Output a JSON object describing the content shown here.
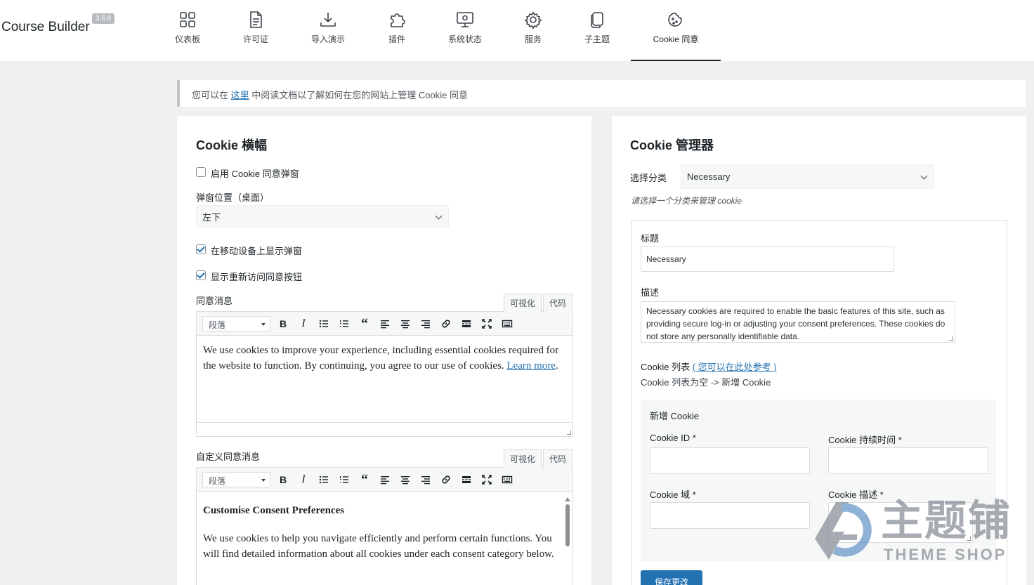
{
  "brand": {
    "name": "Course Builder",
    "version": "3.6.8"
  },
  "nav": [
    {
      "label": "仪表板",
      "icon": "dashboard-icon"
    },
    {
      "label": "许可证",
      "icon": "document-icon"
    },
    {
      "label": "导入演示",
      "icon": "download-icon"
    },
    {
      "label": "插件",
      "icon": "puzzle-icon"
    },
    {
      "label": "系统状态",
      "icon": "monitor-gear-icon"
    },
    {
      "label": "服务",
      "icon": "gear-icon"
    },
    {
      "label": "子主题",
      "icon": "copy-icon"
    },
    {
      "label": "Cookie 同意",
      "icon": "cookie-icon",
      "active": true
    }
  ],
  "notice": {
    "before": "您可以在 ",
    "link": "这里",
    "after": " 中阅读文档以了解如何在您的网站上管理 Cookie 同意"
  },
  "banner": {
    "title": "Cookie 横幅",
    "enable_label": "启用 Cookie 同意弹窗",
    "enable_checked": false,
    "position_label": "弹窗位置（桌面）",
    "position_value": "左下",
    "mobile_label": "在移动设备上显示弹窗",
    "mobile_checked": true,
    "revisit_label": "显示重新访问同意按钮",
    "revisit_checked": true,
    "consent_label": "同意消息",
    "custom_label": "自定义同意消息",
    "tab_visual": "可视化",
    "tab_code": "代码",
    "format_select": "段落",
    "consent_text": "We use cookies to improve your experience, including essential cookies required for the website to function. By continuing, you agree to our use of cookies. ",
    "consent_link": "Learn more",
    "consent_end": ".",
    "custom_heading": "Customise Consent Preferences",
    "custom_text": "We use cookies to help you navigate efficiently and perform certain functions. You will find detailed information about all cookies under each consent category below."
  },
  "manager": {
    "title": "Cookie 管理器",
    "category_label": "选择分类",
    "category_value": "Necessary",
    "hint": "请选择一个分类来管理 cookie",
    "title_label": "标题",
    "title_value": "Necessary",
    "desc_label": "描述",
    "desc_value": "Necessary cookies are required to enable the basic features of this site, such as providing secure log-in or adjusting your consent preferences. These cookies do not store any personally identifiable data.",
    "list_label": "Cookie 列表",
    "list_link": "( 您可以在此处参考 )",
    "list_empty": "Cookie 列表为空 -> 新增 Cookie",
    "new_title": "新增 Cookie",
    "id_label": "Cookie ID *",
    "duration_label": "Cookie 持续时间 *",
    "domain_label": "Cookie 域 *",
    "cookie_desc_label": "Cookie 描述 *",
    "save_label": "保存更改"
  },
  "watermark": {
    "text": "主题铺",
    "sub": "THEME SHOP"
  }
}
